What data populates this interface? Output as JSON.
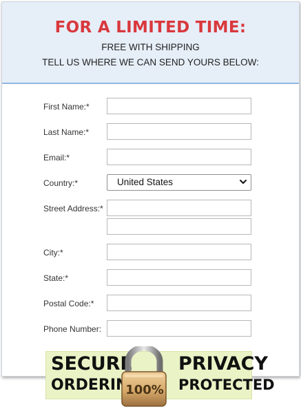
{
  "header": {
    "headline": "FOR A LIMITED TIME:",
    "line1": "FREE WITH SHIPPING",
    "line2": "TELL US WHERE WE CAN SEND YOURS BELOW:"
  },
  "form": {
    "first_name_label": "First Name:*",
    "last_name_label": "Last Name:*",
    "email_label": "Email:*",
    "country_label": "Country:*",
    "country_value": "United States",
    "street_label": "Street Address:*",
    "city_label": "City:*",
    "state_label": "State:*",
    "postal_label": "Postal Code:*",
    "phone_label": "Phone Number:"
  },
  "badge": {
    "left_top": "SECURE",
    "left_bottom": "ORDERING",
    "right_top": "PRIVACY",
    "right_bottom": "PROTECTED",
    "lock_text": "100%"
  },
  "icons": {
    "dropdown": "chevron-down-icon",
    "lock": "padlock-icon"
  },
  "colors": {
    "headline": "#d9383d",
    "header_bg": "#e6eef8",
    "header_border": "#8fb6e0",
    "badge_bg": "#eaf3c6",
    "lock_gold": "#d6a96a"
  }
}
